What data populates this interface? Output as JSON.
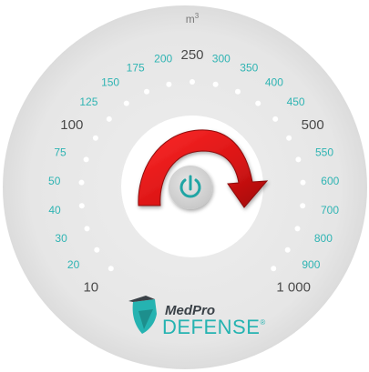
{
  "unit": "m",
  "unit_exponent": "3",
  "scale": {
    "labels": [
      {
        "text": "10",
        "major": true
      },
      {
        "text": "20",
        "major": false
      },
      {
        "text": "30",
        "major": false
      },
      {
        "text": "40",
        "major": false
      },
      {
        "text": "50",
        "major": false
      },
      {
        "text": "75",
        "major": false
      },
      {
        "text": "100",
        "major": true
      },
      {
        "text": "125",
        "major": false
      },
      {
        "text": "150",
        "major": false
      },
      {
        "text": "175",
        "major": false
      },
      {
        "text": "200",
        "major": false
      },
      {
        "text": "250",
        "major": true
      },
      {
        "text": "300",
        "major": false
      },
      {
        "text": "350",
        "major": false
      },
      {
        "text": "400",
        "major": false
      },
      {
        "text": "450",
        "major": false
      },
      {
        "text": "500",
        "major": true
      },
      {
        "text": "550",
        "major": false
      },
      {
        "text": "600",
        "major": false
      },
      {
        "text": "700",
        "major": false
      },
      {
        "text": "800",
        "major": false
      },
      {
        "text": "900",
        "major": false
      },
      {
        "text": "1 000",
        "major": true
      }
    ]
  },
  "brand": {
    "line1": "MedPro",
    "line2": "DEFENSE",
    "registered": "®"
  },
  "icons": {
    "power": "power-icon",
    "arrow": "clockwise-arrow-icon",
    "logo": "shield-logo-icon"
  },
  "colors": {
    "bezel": "#e7e7e7",
    "face": "#ffffff",
    "teal": "#2fb4b3",
    "major_label": "#4a4a4a",
    "dot": "#ffffff",
    "button": "#d4d4d4",
    "power_icon": "#20a5a4",
    "arrow": "#e01818",
    "arrow_dark": "#8c0c0c",
    "brand_dark": "#3a4147",
    "brand_teal": "#25b3b1"
  }
}
